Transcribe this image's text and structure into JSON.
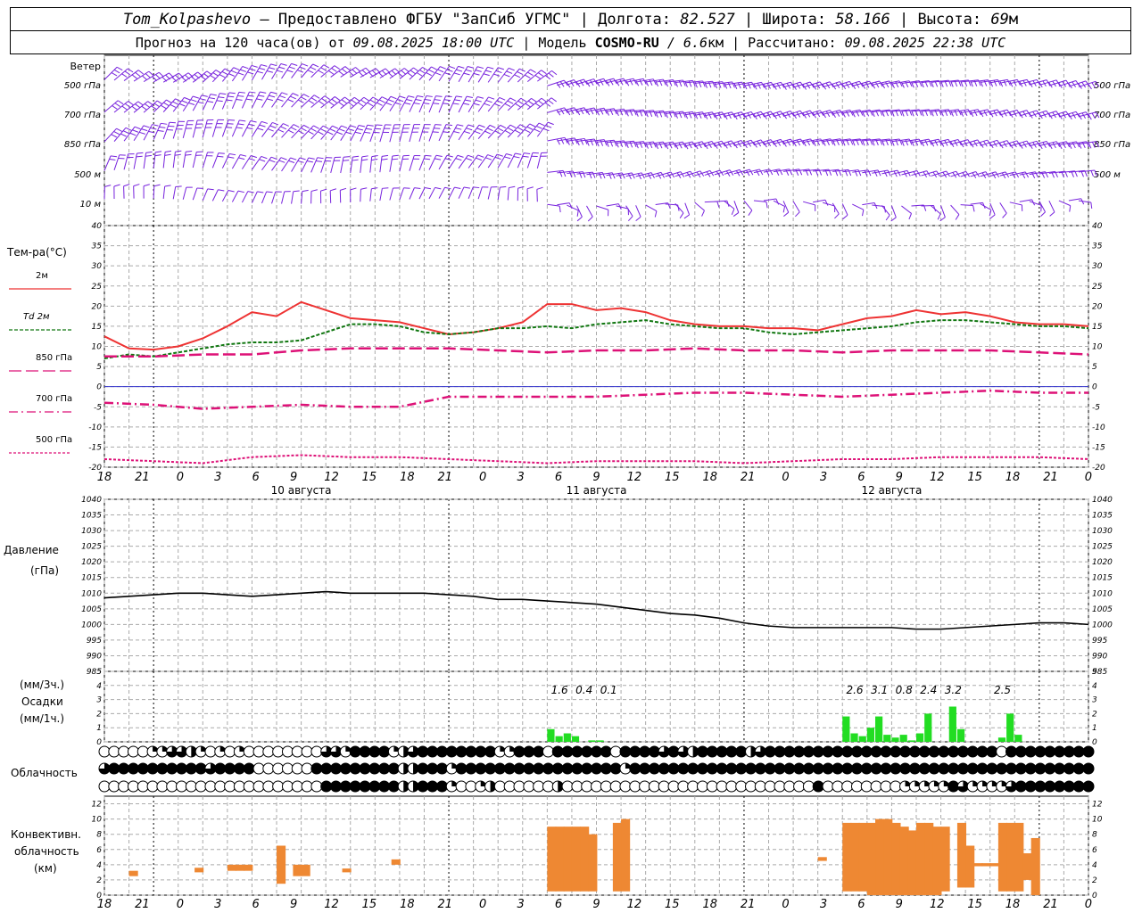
{
  "header": {
    "station": "Tom_Kolpashevo",
    "provider": "— Предоставлено ФГБУ \"ЗапСиб УГМС\" |",
    "lon_label": "Долгота:",
    "lon": "82.527",
    "lat_label": "| Широта:",
    "lat": "58.166",
    "alt_label": "| Высота:",
    "alt": "69",
    "alt_unit": "м",
    "forecast_label": "Прогноз на 120 часа(ов) от",
    "forecast_start": "09.08.2025 18:00 UTC",
    "model_label": "| Модель",
    "model": "COSMO-RU",
    "resolution": "/ 6.6",
    "res_unit": "км",
    "calc_label": "| Рассчитано:",
    "calc_time": "09.08.2025 22:38 UTC"
  },
  "labels": {
    "wind": "Ветер",
    "wind_levels": [
      "500 гПа",
      "700 гПа",
      "850 гПа",
      "500 м",
      "10  м"
    ],
    "temp_title": "Тем-ра(°C)",
    "legend": [
      "2м",
      "Td  2м",
      "850 гПа",
      "700 гПа",
      "500 гПа"
    ],
    "pressure_title": "Давление",
    "pressure_unit": "(гПа)",
    "precip_unit3": "(мм/3ч.)",
    "precip_title": "Осадки",
    "precip_unit1": "(мм/1ч.)",
    "cloud_title": "Облачность",
    "conv_title1": "Конвективн.",
    "conv_title2": "облачность",
    "conv_unit": "(км)",
    "dates": [
      "10 августа",
      "11 августа",
      "12 августа"
    ]
  },
  "colors": {
    "t2m": "#ee3333",
    "td2m": "#117711",
    "t850": "#dd1177",
    "t700": "#dd1177",
    "t500": "#dd1177",
    "wind": "#7722dd",
    "precip": "#22dd22",
    "conv": "#ee8833",
    "zero_line": "#3333cc"
  },
  "chart_data": {
    "type": "line",
    "x_hours_labels": [
      "18",
      "21",
      "0",
      "3",
      "6",
      "9",
      "12",
      "15",
      "18",
      "21",
      "0",
      "3",
      "6",
      "9",
      "12",
      "15",
      "18",
      "21",
      "0",
      "3",
      "6",
      "9",
      "12",
      "15",
      "18",
      "21",
      "0"
    ],
    "temperature": {
      "ylim": [
        -20,
        40
      ],
      "yticks": [
        -20,
        -15,
        -10,
        -5,
        0,
        5,
        10,
        15,
        20,
        25,
        30,
        35,
        40
      ],
      "series": [
        {
          "name": "2м",
          "hours": [
            0,
            3,
            6,
            9,
            12,
            15,
            18,
            21,
            24,
            27,
            30,
            33,
            36,
            39,
            42,
            45,
            48,
            51,
            54,
            57,
            60,
            63,
            66,
            69,
            72,
            75,
            78,
            81,
            84,
            87,
            90,
            93,
            96,
            99,
            102,
            105,
            108,
            111,
            114,
            117,
            120
          ],
          "values": [
            12.5,
            9.5,
            9.2,
            10.0,
            12.0,
            15.0,
            18.5,
            17.5,
            21.0,
            19.0,
            17.0,
            16.5,
            16.0,
            14.5,
            13.0,
            13.5,
            14.5,
            16.0,
            20.5,
            20.5,
            19.0,
            19.5,
            18.5,
            16.5,
            15.5,
            15.0,
            15.0,
            14.5,
            14.5,
            14.0,
            15.5,
            17.0,
            17.5,
            19.0,
            18.0,
            18.5,
            17.5,
            16.0,
            15.5,
            15.5,
            15.0
          ]
        },
        {
          "name": "Td  2м",
          "hours": [
            0,
            3,
            6,
            9,
            12,
            15,
            18,
            21,
            24,
            27,
            30,
            33,
            36,
            39,
            42,
            45,
            48,
            51,
            54,
            57,
            60,
            63,
            66,
            69,
            72,
            75,
            78,
            81,
            84,
            87,
            90,
            93,
            96,
            99,
            102,
            105,
            108,
            111,
            114,
            117,
            120
          ],
          "values": [
            7.0,
            8.0,
            7.5,
            8.5,
            9.5,
            10.5,
            11.0,
            11.0,
            11.5,
            13.5,
            15.5,
            15.5,
            15.0,
            13.5,
            13.0,
            13.5,
            14.5,
            14.5,
            15.0,
            14.5,
            15.5,
            16.0,
            16.5,
            15.5,
            15.0,
            14.5,
            14.5,
            13.5,
            13.0,
            13.5,
            14.0,
            14.5,
            15.0,
            16.0,
            16.5,
            16.5,
            16.0,
            15.5,
            15.0,
            15.0,
            14.5
          ]
        },
        {
          "name": "850 гПа",
          "hours": [
            0,
            6,
            12,
            18,
            24,
            30,
            36,
            42,
            48,
            54,
            60,
            66,
            72,
            78,
            84,
            90,
            96,
            102,
            108,
            114,
            120
          ],
          "values": [
            7.5,
            7.5,
            8.0,
            8.0,
            9.0,
            9.5,
            9.5,
            9.5,
            9.0,
            8.5,
            9.0,
            9.0,
            9.5,
            9.0,
            9.0,
            8.5,
            9.0,
            9.0,
            9.0,
            8.5,
            8.0
          ]
        },
        {
          "name": "700 гПа",
          "hours": [
            0,
            6,
            12,
            18,
            24,
            30,
            36,
            42,
            48,
            54,
            60,
            66,
            72,
            78,
            84,
            90,
            96,
            102,
            108,
            114,
            120
          ],
          "values": [
            -4.0,
            -4.5,
            -5.5,
            -5.0,
            -4.5,
            -5.0,
            -5.0,
            -2.5,
            -2.5,
            -2.5,
            -2.5,
            -2.0,
            -1.5,
            -1.5,
            -2.0,
            -2.5,
            -2.0,
            -1.5,
            -1.0,
            -1.5,
            -1.5
          ]
        },
        {
          "name": "500 гПа",
          "hours": [
            0,
            6,
            12,
            18,
            24,
            30,
            36,
            42,
            48,
            54,
            60,
            66,
            72,
            78,
            84,
            90,
            96,
            102,
            108,
            114,
            120
          ],
          "values": [
            -18.0,
            -18.5,
            -19.0,
            -17.5,
            -17.0,
            -17.5,
            -17.5,
            -18.0,
            -18.5,
            -19.0,
            -18.5,
            -18.5,
            -18.5,
            -19.0,
            -18.5,
            -18.0,
            -18.0,
            -17.5,
            -17.5,
            -17.5,
            -18.0
          ]
        }
      ]
    },
    "pressure": {
      "ylim": [
        985,
        1040
      ],
      "yticks": [
        985,
        990,
        995,
        1000,
        1005,
        1010,
        1015,
        1020,
        1025,
        1030,
        1035,
        1040
      ],
      "hours": [
        0,
        3,
        6,
        9,
        12,
        15,
        18,
        21,
        24,
        27,
        30,
        33,
        36,
        39,
        42,
        45,
        48,
        51,
        54,
        57,
        60,
        63,
        66,
        69,
        72,
        75,
        78,
        81,
        84,
        87,
        90,
        93,
        96,
        99,
        102,
        105,
        108,
        111,
        114,
        117,
        120
      ],
      "values": [
        1008.5,
        1009.0,
        1009.5,
        1010.0,
        1010.0,
        1009.5,
        1009.0,
        1009.5,
        1010.0,
        1010.5,
        1010.0,
        1010.0,
        1010.0,
        1010.0,
        1009.5,
        1009.0,
        1008.0,
        1008.0,
        1007.5,
        1007.0,
        1006.5,
        1005.5,
        1004.5,
        1003.5,
        1003.0,
        1002.0,
        1000.5,
        999.5,
        999.0,
        999.0,
        999.0,
        999.0,
        999.0,
        998.5,
        998.5,
        999.0,
        999.5,
        1000.0,
        1000.5,
        1000.5,
        1000.0
      ]
    },
    "precipitation": {
      "ylim": [
        0,
        5
      ],
      "yticks": [
        0,
        1,
        2,
        3,
        4,
        5
      ],
      "hourly_mm": [
        [
          54,
          0.9
        ],
        [
          55,
          0.4
        ],
        [
          56,
          0.6
        ],
        [
          57,
          0.4
        ],
        [
          59,
          0.1
        ],
        [
          60,
          0.1
        ],
        [
          90,
          1.8
        ],
        [
          91,
          0.6
        ],
        [
          92,
          0.4
        ],
        [
          93,
          1.0
        ],
        [
          94,
          1.8
        ],
        [
          95,
          0.5
        ],
        [
          96,
          0.3
        ],
        [
          97,
          0.5
        ],
        [
          98,
          0.1
        ],
        [
          99,
          0.6
        ],
        [
          100,
          2.0
        ],
        [
          103,
          2.5
        ],
        [
          104,
          0.9
        ],
        [
          109,
          0.3
        ],
        [
          110,
          2.0
        ],
        [
          111,
          0.5
        ]
      ],
      "sum3h_labels": [
        [
          55.5,
          "1.6"
        ],
        [
          58.5,
          "0.4"
        ],
        [
          61.5,
          "0.1"
        ],
        [
          91.5,
          "2.6"
        ],
        [
          94.5,
          "3.1"
        ],
        [
          97.5,
          "0.8"
        ],
        [
          100.5,
          "2.4"
        ],
        [
          103.5,
          "3.2"
        ],
        [
          109.5,
          "2.5"
        ]
      ]
    },
    "cloudiness": {
      "rows": [
        "0000011332101010000000033144441234444444411444044444404444343244444234444444444444444444444440444444444",
        "3444444444434444000000444444444224441444444444444444441444444444444444444444444444444444444444444444444",
        "0000000000000000000000044444444224441001200000020000000000000000000000000040000000011111431111344444444"
      ]
    },
    "convective_clouds": {
      "ylim": [
        0,
        13
      ],
      "yticks": [
        0,
        2,
        4,
        6,
        8,
        10,
        12
      ],
      "bars": [
        [
          3,
          2.5,
          3.2
        ],
        [
          11,
          3.0,
          3.6
        ],
        [
          15,
          3.2,
          4.0
        ],
        [
          16,
          3.2,
          4.0
        ],
        [
          17,
          3.2,
          4.0
        ],
        [
          21,
          1.5,
          6.5
        ],
        [
          23,
          2.5,
          4.0
        ],
        [
          24,
          2.5,
          4.0
        ],
        [
          29,
          3.0,
          3.5
        ],
        [
          35,
          4.0,
          4.7
        ],
        [
          54,
          0.5,
          9.0
        ],
        [
          55,
          0.5,
          9.0
        ],
        [
          56,
          0.5,
          9.0
        ],
        [
          57,
          0.5,
          9.0
        ],
        [
          58,
          0.5,
          9.0
        ],
        [
          59,
          0.5,
          8.0
        ],
        [
          62,
          0.5,
          9.5
        ],
        [
          63,
          0.5,
          10.0
        ],
        [
          87,
          4.5,
          5.0
        ],
        [
          90,
          0.5,
          9.5
        ],
        [
          91,
          0.5,
          9.5
        ],
        [
          92,
          0.5,
          9.5
        ],
        [
          93,
          0.0,
          9.5
        ],
        [
          94,
          0.0,
          10.0
        ],
        [
          95,
          0.0,
          10.0
        ],
        [
          96,
          0.0,
          9.5
        ],
        [
          97,
          0.0,
          9.0
        ],
        [
          98,
          0.0,
          8.5
        ],
        [
          99,
          0.0,
          9.5
        ],
        [
          100,
          0.0,
          9.5
        ],
        [
          101,
          0.0,
          9.0
        ],
        [
          102,
          0.5,
          9.0
        ],
        [
          104,
          1.0,
          9.5
        ],
        [
          105,
          1.0,
          6.5
        ],
        [
          106,
          3.8,
          4.2
        ],
        [
          107,
          3.8,
          4.2
        ],
        [
          108,
          3.8,
          4.2
        ],
        [
          109,
          0.5,
          9.5
        ],
        [
          110,
          0.5,
          9.5
        ],
        [
          111,
          0.5,
          9.5
        ],
        [
          112,
          2.0,
          5.5
        ],
        [
          113,
          0.0,
          7.5
        ]
      ]
    }
  }
}
